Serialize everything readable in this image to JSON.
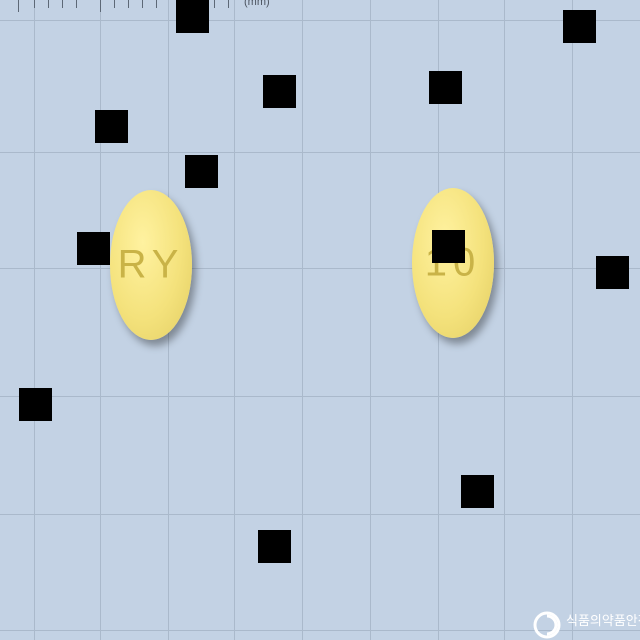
{
  "scale": {
    "unit_label": "(mm)"
  },
  "pills": [
    {
      "imprint": "RY",
      "color": "#f2e079"
    },
    {
      "imprint": "10",
      "color": "#f2e079"
    }
  ],
  "watermark": {
    "text": "식품의약품안전처",
    "logo_icon": "mfds-logo-icon"
  }
}
